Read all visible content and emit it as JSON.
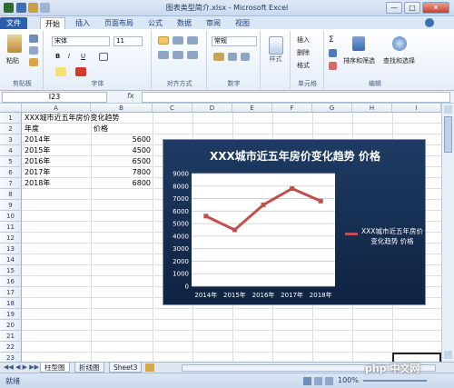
{
  "window": {
    "title": "图表类型简介.xlsx - Microsoft Excel",
    "controls": {
      "minimize": "—",
      "maximize": "□",
      "close": "✕"
    }
  },
  "ribbon_tabs": [
    "文件",
    "开始",
    "插入",
    "页面布局",
    "公式",
    "数据",
    "审阅",
    "视图"
  ],
  "ribbon": {
    "clipboard": {
      "paste": "粘贴",
      "label": "剪贴板"
    },
    "font": {
      "name": "宋体",
      "size": "11",
      "bold": "B",
      "italic": "I",
      "underline": "U",
      "label": "字体"
    },
    "alignment": {
      "label": "对齐方式"
    },
    "number": {
      "format": "常规",
      "label": "数字"
    },
    "styles": {
      "label": "样式"
    },
    "cells": {
      "insert": "插入",
      "delete": "删除",
      "format": "格式",
      "label": "单元格"
    },
    "editing": {
      "sort_filter": "排序和筛选",
      "find_select": "查找和选择",
      "label": "编辑"
    }
  },
  "formula_bar": {
    "cell_ref": "I23",
    "fx": "fx",
    "content": ""
  },
  "columns": [
    "A",
    "B",
    "C",
    "D",
    "E",
    "F",
    "G",
    "H",
    "I"
  ],
  "rows": [
    "1",
    "2",
    "3",
    "4",
    "5",
    "6",
    "7",
    "8",
    "9",
    "10",
    "11",
    "12",
    "13",
    "14",
    "15",
    "16",
    "17",
    "18",
    "19",
    "20",
    "21",
    "22",
    "23"
  ],
  "cells": {
    "A1": "XXX城市近五年房价变化趋势",
    "A2": "年度",
    "B2": "价格",
    "A3": "2014年",
    "B3": "5600",
    "A4": "2015年",
    "B4": "4500",
    "A5": "2016年",
    "B5": "6500",
    "A6": "2017年",
    "B6": "7800",
    "A7": "2018年",
    "B7": "6800"
  },
  "chart_data": {
    "type": "line",
    "title": "XXX城市近五年房价变化趋势 价格",
    "categories": [
      "2014年",
      "2015年",
      "2016年",
      "2017年",
      "2018年"
    ],
    "series": [
      {
        "name": "XXX城市近五年房价变化趋势 价格",
        "values": [
          5600,
          4500,
          6500,
          7800,
          6800
        ]
      }
    ],
    "yticks": [
      "0",
      "1000",
      "2000",
      "3000",
      "4000",
      "5000",
      "6000",
      "7000",
      "8000",
      "9000"
    ],
    "ylim": [
      0,
      9000
    ],
    "grid": true,
    "legend": "right",
    "colors": {
      "line": "#c0504d",
      "background": "#1f3b63",
      "plot": "#ffffff"
    }
  },
  "sheet_tabs": [
    "柱型图",
    "折线图",
    "Sheet3"
  ],
  "status": {
    "ready": "就绪",
    "zoom": "100%",
    "watermark": "php 中文网"
  }
}
